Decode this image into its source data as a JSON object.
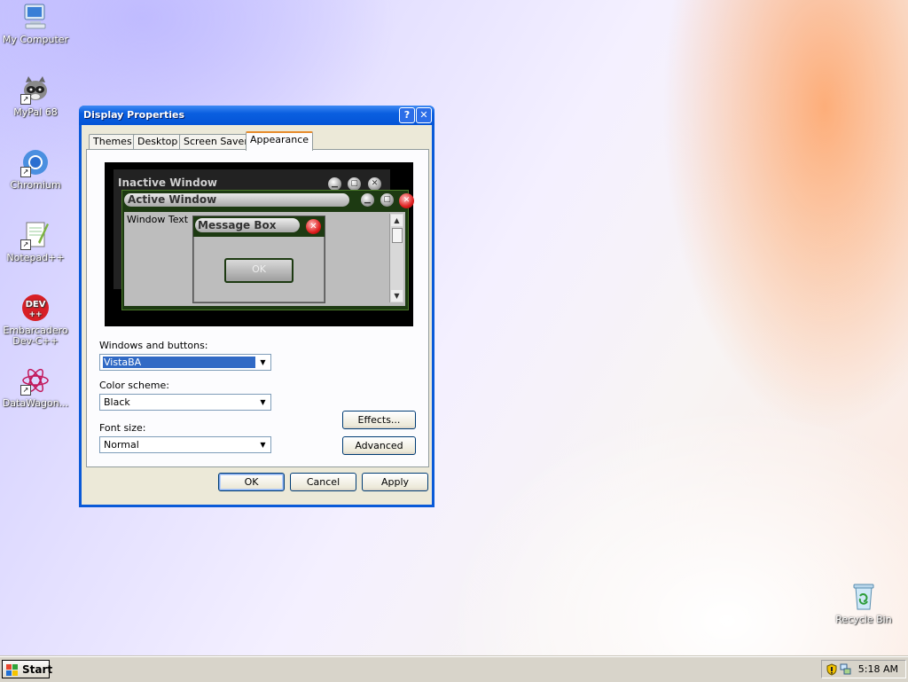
{
  "desktop": {
    "icons": [
      {
        "label": "My Computer"
      },
      {
        "label": "MyPal 68"
      },
      {
        "label": "Chromium"
      },
      {
        "label": "Notepad++"
      },
      {
        "label": "Embarcadero Dev-C++"
      },
      {
        "label": "DataWagon..."
      },
      {
        "label": "Recycle Bin"
      }
    ]
  },
  "dialog": {
    "title": "Display Properties",
    "help_glyph": "?",
    "close_glyph": "✕",
    "tabs": [
      {
        "label": "Themes"
      },
      {
        "label": "Desktop"
      },
      {
        "label": "Screen Saver"
      },
      {
        "label": "Appearance",
        "selected": true
      }
    ],
    "preview": {
      "inactive_title": "Inactive Window",
      "active_title": "Active Window",
      "window_text": "Window Text",
      "message_box_title": "Message Box",
      "message_ok": "OK"
    },
    "windows_buttons_label": "Windows and buttons:",
    "windows_buttons_value": "VistaBA",
    "color_scheme_label": "Color scheme:",
    "color_scheme_value": "Black",
    "font_size_label": "Font size:",
    "font_size_value": "Normal",
    "effects_button": "Effects...",
    "advanced_button": "Advanced",
    "ok_button": "OK",
    "cancel_button": "Cancel",
    "apply_button": "Apply"
  },
  "taskbar": {
    "start_label": "Start",
    "clock": "5:18 AM"
  },
  "colors": {
    "title_blue": "#0454d6",
    "selected_tab_accent": "#e68b2c",
    "selection_blue": "#316ac5"
  }
}
